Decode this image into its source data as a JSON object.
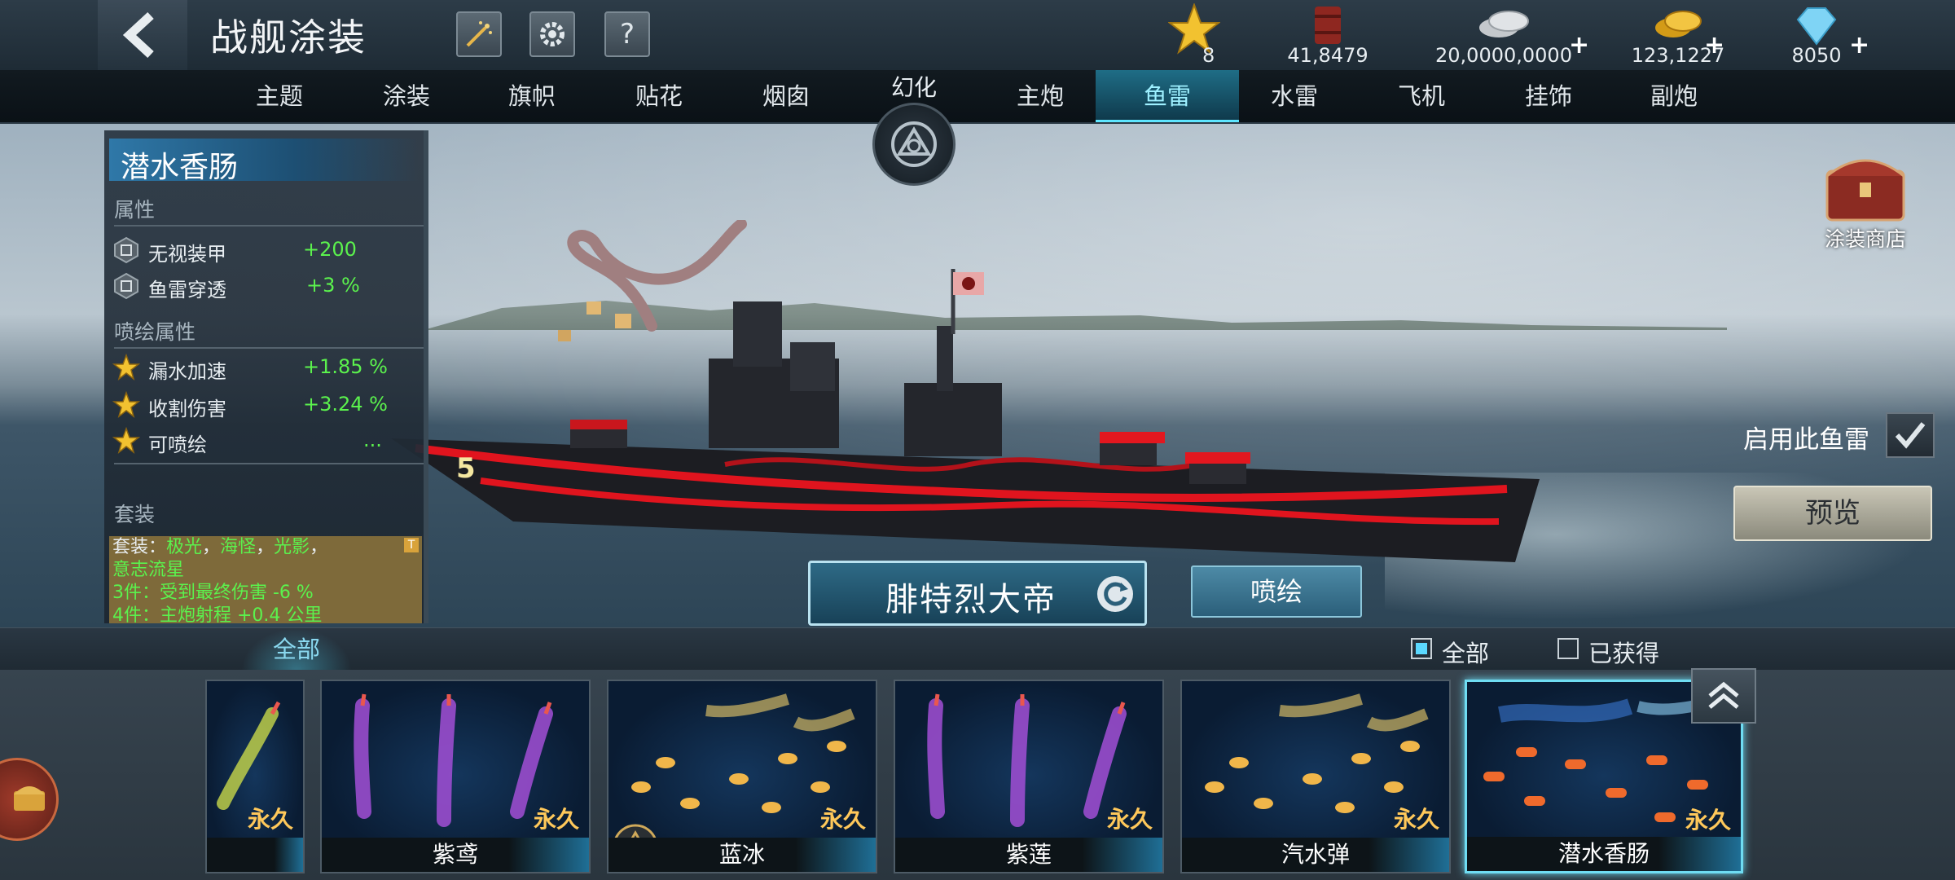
{
  "header": {
    "title": "战舰涂装",
    "resources": [
      {
        "name": "star",
        "value": "8",
        "icon": "star-icon"
      },
      {
        "name": "oil",
        "value": "41,8479",
        "icon": "oil-barrel-icon"
      },
      {
        "name": "silver",
        "value": "20,0000,0000",
        "icon": "silver-coin-icon"
      },
      {
        "name": "gold",
        "value": "123,1227",
        "icon": "gold-coin-icon"
      },
      {
        "name": "diamond",
        "value": "8050",
        "icon": "diamond-icon"
      }
    ]
  },
  "tabs": {
    "left": [
      "主题",
      "涂装",
      "旗帜",
      "贴花",
      "烟囱"
    ],
    "center": "幻化",
    "right": [
      "主炮",
      "鱼雷",
      "水雷",
      "飞机",
      "挂饰",
      "副炮"
    ],
    "active": "鱼雷"
  },
  "info": {
    "skin_name": "潜水香肠",
    "attr_header": "属性",
    "attributes": [
      {
        "name": "无视装甲",
        "value": "+200"
      },
      {
        "name": "鱼雷穿透",
        "value": "+3 %"
      }
    ],
    "spray_header": "喷绘属性",
    "spray_attributes": [
      {
        "name": "漏水加速",
        "value": "+1.85 %"
      },
      {
        "name": "收割伤害",
        "value": "+3.24 %"
      },
      {
        "name": "可喷绘",
        "value": "..."
      }
    ],
    "set_header": "套装",
    "set_lines": {
      "l1_prefix": "套装：",
      "l1_a": "极光",
      "l1_b": "海怪",
      "l1_c": "光影",
      "l2": "意志流星",
      "l3": "3件：受到最终伤害 -6 %",
      "l4": "4件：主炮射程 +0.4 公里",
      "sep": "，"
    },
    "set_badge": "T"
  },
  "ship": {
    "name": "腓特烈大帝",
    "hull_number": "5"
  },
  "actions": {
    "spray": "喷绘",
    "enable": "启用此鱼雷",
    "enabled": true,
    "preview": "预览",
    "store": "涂装商店"
  },
  "filter": {
    "all_tab": "全部",
    "opt_all": "全部",
    "opt_all_checked": true,
    "opt_owned": "已获得",
    "opt_owned_checked": false
  },
  "cards": [
    {
      "name": "",
      "tag": "永久",
      "color": "#c8d84a"
    },
    {
      "name": "紫鸢",
      "tag": "永久",
      "color": "#a24fd6"
    },
    {
      "name": "蓝冰",
      "tag": "永久",
      "color": "#f0b64a"
    },
    {
      "name": "紫莲",
      "tag": "永久",
      "color": "#a24fd6"
    },
    {
      "name": "汽水弹",
      "tag": "永久",
      "color": "#f0b64a"
    },
    {
      "name": "潜水香肠",
      "tag": "永久",
      "color": "#ef6a2c"
    }
  ],
  "colors": {
    "accent": "#5ee6ff",
    "positive": "#5bf24d",
    "permanent": "#ffc85a"
  }
}
